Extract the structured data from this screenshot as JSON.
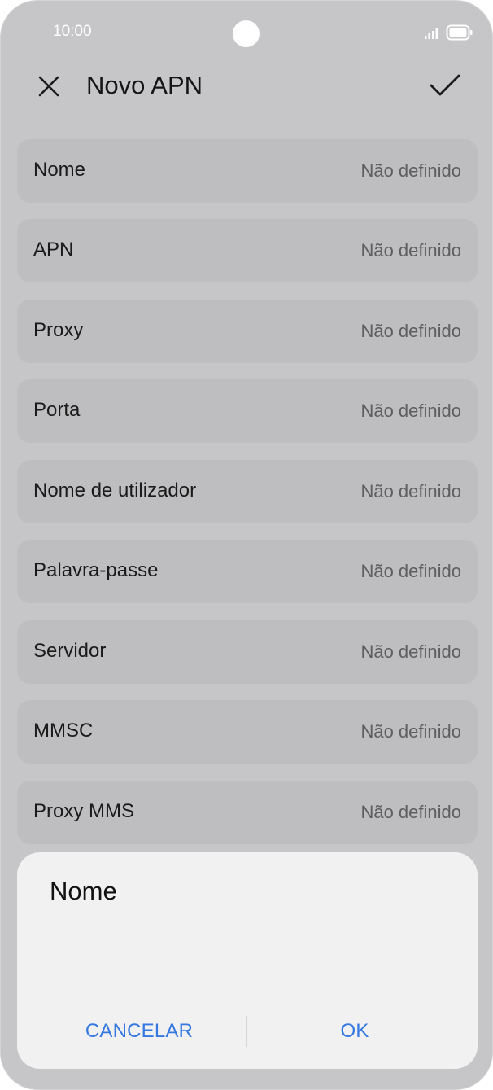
{
  "status_bar": {
    "time": "10:00",
    "icons": [
      "signal-icon",
      "battery-icon"
    ]
  },
  "header": {
    "title": "Novo APN",
    "close_icon": "close-icon",
    "confirm_icon": "check-icon"
  },
  "settings": [
    {
      "label": "Nome",
      "value": "Não definido"
    },
    {
      "label": "APN",
      "value": "Não definido"
    },
    {
      "label": "Proxy",
      "value": "Não definido"
    },
    {
      "label": "Porta",
      "value": "Não definido"
    },
    {
      "label": "Nome de utilizador",
      "value": "Não definido"
    },
    {
      "label": "Palavra-passe",
      "value": "Não definido"
    },
    {
      "label": "Servidor",
      "value": "Não definido"
    },
    {
      "label": "MMSC",
      "value": "Não definido"
    },
    {
      "label": "Proxy MMS",
      "value": "Não definido"
    }
  ],
  "dialog": {
    "title": "Nome",
    "input_value": "",
    "cancel_label": "CANCELAR",
    "ok_label": "OK"
  },
  "colors": {
    "accent": "#3478e0",
    "overlay_background": "#c6c6c8",
    "row_background": "#bebec0",
    "dialog_background": "#f1f1f1"
  }
}
